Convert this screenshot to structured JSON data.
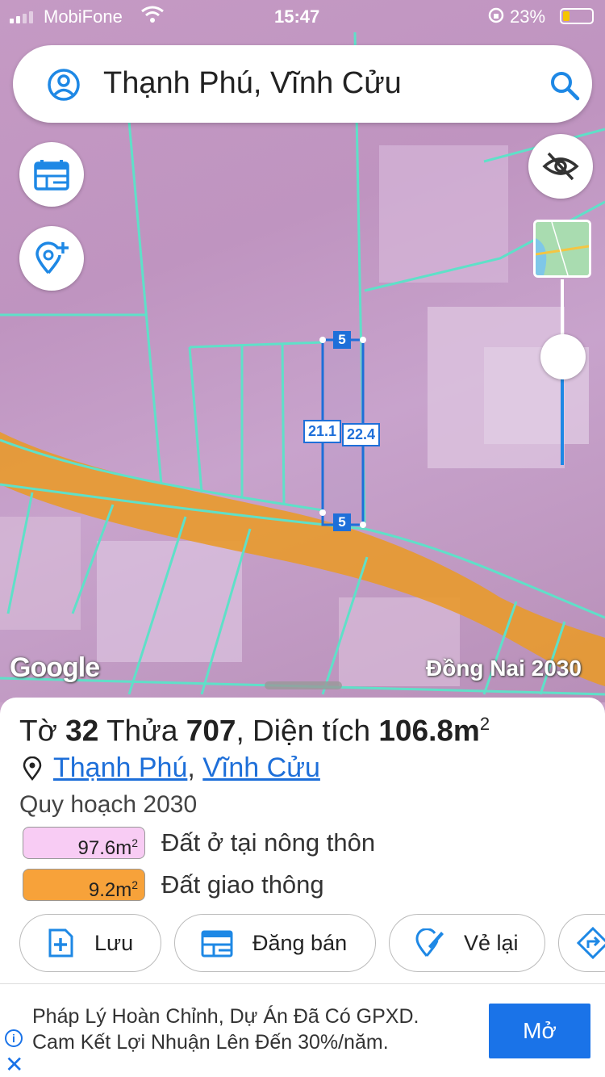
{
  "status_bar": {
    "carrier": "MobiFone",
    "time": "15:47",
    "battery": "23%"
  },
  "search": {
    "query": "Thạnh Phú, Vĩnh Cửu"
  },
  "map": {
    "attribution": "Google",
    "layer_label": "Đồng Nai 2030",
    "dimensions": {
      "top": "5",
      "bottom": "5",
      "left": "21.1",
      "right": "22.4"
    },
    "colors": {
      "residential": "#c49bc6",
      "road": "#e89a2c",
      "parcel_lines": "#5fe0c8",
      "selection": "#1e6fd9"
    }
  },
  "parcel": {
    "sheet_prefix": "Tờ",
    "sheet_no": "32",
    "plot_prefix": "Thửa",
    "plot_no": "707",
    "area_prefix": "Diện tích",
    "area": "106.8m",
    "area_unit_sup": "2",
    "ward": "Thạnh Phú",
    "district": "Vĩnh Cửu",
    "plan": "Quy hoạch 2030",
    "zones": [
      {
        "area": "97.6m",
        "name": "Đất ở tại nông thôn",
        "color": "#f8ccf4"
      },
      {
        "area": "9.2m",
        "name": "Đất giao thông",
        "color": "#f7a23a"
      }
    ]
  },
  "actions": {
    "save": "Lưu",
    "sell": "Đăng bán",
    "redraw": "Vẻ lại"
  },
  "ad": {
    "line1": "Pháp Lý Hoàn Chỉnh, Dự Án Đã Có GPXD.",
    "line2": "Cam Kết Lợi Nhuận Lên Đến 30%/năm.",
    "button": "Mở"
  }
}
